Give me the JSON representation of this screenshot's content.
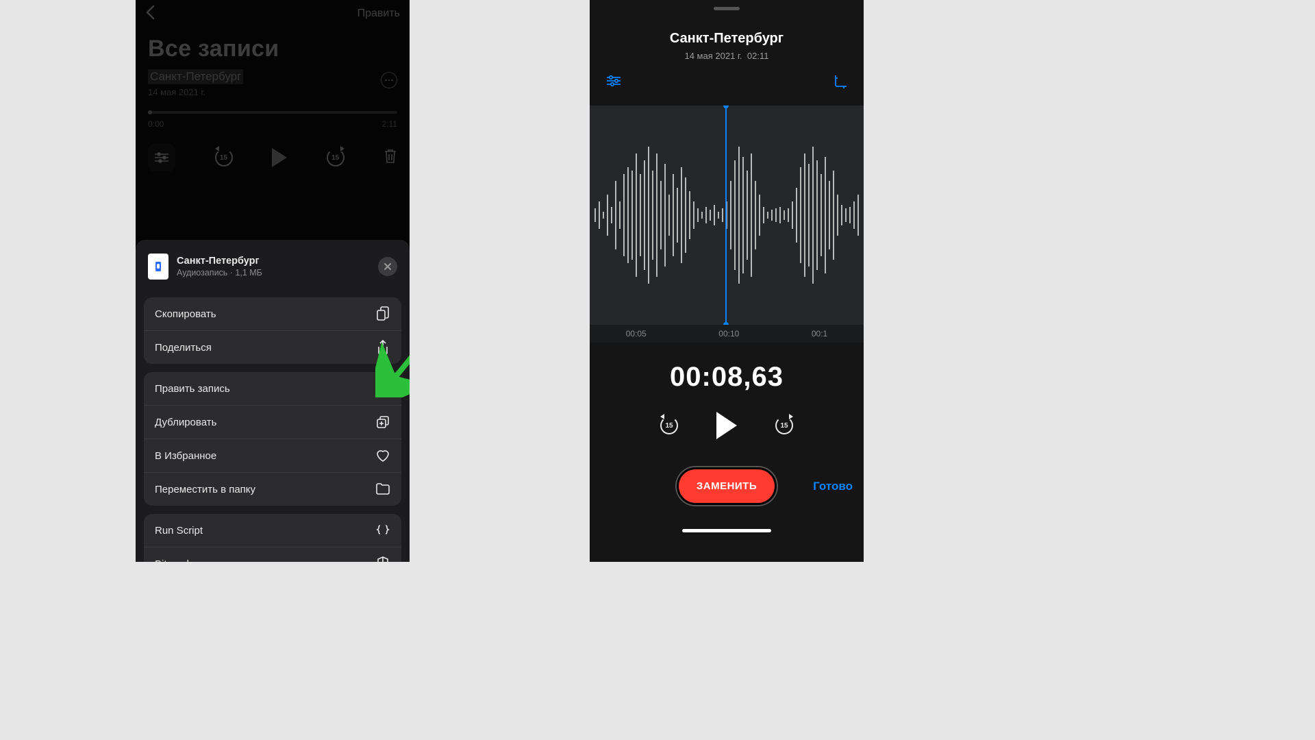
{
  "left": {
    "edit": "Править",
    "heading": "Все записи",
    "item": {
      "title": "Санкт-Петербург",
      "date": "14 мая 2021 г.",
      "start": "0:00",
      "end": "2:11"
    },
    "skip": "15",
    "sheet": {
      "title": "Санкт-Петербург",
      "subtitle": "Аудиозапись · 1,1 МБ",
      "copy": "Скопировать",
      "share": "Поделиться",
      "editRec": "Править запись",
      "duplicate": "Дублировать",
      "favorite": "В Избранное",
      "moveFolder": "Переместить в папку",
      "runScript": "Run Script",
      "bitwarden": "Bitwarden"
    }
  },
  "right": {
    "title": "Санкт-Петербург",
    "date": "14 мая 2021 г.",
    "duration": "02:11",
    "ruler": [
      "00:05",
      "00:10",
      "00:1"
    ],
    "time": "00:08,63",
    "skip": "15",
    "replace": "ЗАМЕНИТЬ",
    "done": "Готово"
  }
}
